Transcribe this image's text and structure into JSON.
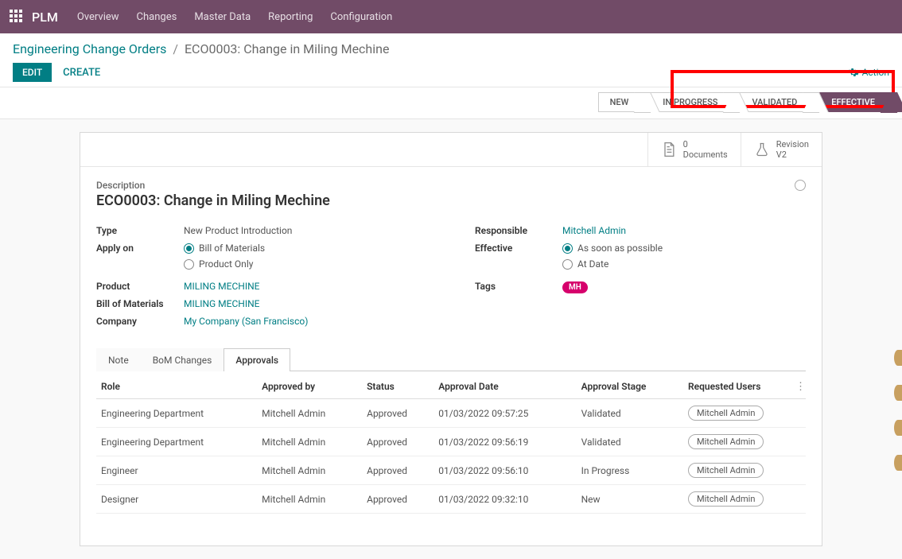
{
  "topbar": {
    "app_name": "PLM",
    "nav": [
      "Overview",
      "Changes",
      "Master Data",
      "Reporting",
      "Configuration"
    ]
  },
  "breadcrumb": {
    "parent": "Engineering Change Orders",
    "current": "ECO0003: Change in Miling Mechine"
  },
  "buttons": {
    "edit": "EDIT",
    "create": "CREATE",
    "action": "Action"
  },
  "stages": [
    "NEW",
    "IN PROGRESS",
    "VALIDATED",
    "EFFECTIVE"
  ],
  "active_stage": "EFFECTIVE",
  "stats": {
    "documents_count": "0",
    "documents_label": "Documents",
    "revision_label": "Revision",
    "revision_value": "V2"
  },
  "record": {
    "desc_label": "Description",
    "title": "ECO0003: Change in Miling Mechine",
    "left_fields": {
      "type_label": "Type",
      "type_value": "New Product Introduction",
      "apply_label": "Apply on",
      "apply_opt1": "Bill of Materials",
      "apply_opt2": "Product Only",
      "product_label": "Product",
      "product_value": "MILING MECHINE",
      "bom_label": "Bill of Materials",
      "bom_value": "MILING MECHINE",
      "company_label": "Company",
      "company_value": "My Company (San Francisco)"
    },
    "right_fields": {
      "responsible_label": "Responsible",
      "responsible_value": "Mitchell Admin",
      "effective_label": "Effective",
      "effective_opt1": "As soon as possible",
      "effective_opt2": "At Date",
      "tags_label": "Tags",
      "tag_value": "MH"
    }
  },
  "tabs": [
    "Note",
    "BoM Changes",
    "Approvals"
  ],
  "table": {
    "headers": [
      "Role",
      "Approved by",
      "Status",
      "Approval Date",
      "Approval Stage",
      "Requested Users"
    ],
    "rows": [
      {
        "role": "Engineering Department",
        "by": "Mitchell Admin",
        "status": "Approved",
        "date": "01/03/2022 09:57:25",
        "stage": "Validated",
        "user": "Mitchell Admin"
      },
      {
        "role": "Engineering Department",
        "by": "Mitchell Admin",
        "status": "Approved",
        "date": "01/03/2022 09:56:19",
        "stage": "Validated",
        "user": "Mitchell Admin"
      },
      {
        "role": "Engineer",
        "by": "Mitchell Admin",
        "status": "Approved",
        "date": "01/03/2022 09:56:10",
        "stage": "In Progress",
        "user": "Mitchell Admin"
      },
      {
        "role": "Designer",
        "by": "Mitchell Admin",
        "status": "Approved",
        "date": "01/03/2022 09:32:10",
        "stage": "New",
        "user": "Mitchell Admin"
      }
    ]
  }
}
